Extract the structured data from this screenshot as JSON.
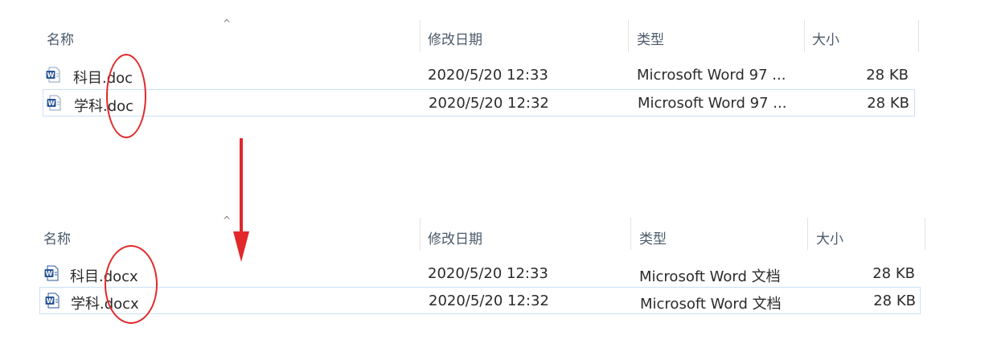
{
  "top": {
    "columns": {
      "name": "名称",
      "modified": "修改日期",
      "type": "类型",
      "size": "大小"
    },
    "sort_glyph": "^",
    "files": [
      {
        "name": "科目.doc",
        "modified": "2020/5/20 12:33",
        "type": "Microsoft Word 97 ...",
        "size": "28 KB",
        "icon": "word-doc-icon"
      },
      {
        "name": "学科.doc",
        "modified": "2020/5/20 12:32",
        "type": "Microsoft Word 97 ...",
        "size": "28 KB",
        "icon": "word-doc-icon"
      }
    ]
  },
  "bottom": {
    "columns": {
      "name": "名称",
      "modified": "修改日期",
      "type": "类型",
      "size": "大小"
    },
    "sort_glyph": "^",
    "files": [
      {
        "name": "科目.docx",
        "modified": "2020/5/20 12:33",
        "type": "Microsoft Word 文档",
        "size": "28 KB",
        "icon": "word-docx-icon"
      },
      {
        "name": "学科.docx",
        "modified": "2020/5/20 12:32",
        "type": "Microsoft Word 文档",
        "size": "28 KB",
        "icon": "word-docx-icon"
      }
    ]
  },
  "colors": {
    "annotation": "#e2282a",
    "selection_border": "#c9e1f7",
    "word_blue": "#2b5797"
  }
}
